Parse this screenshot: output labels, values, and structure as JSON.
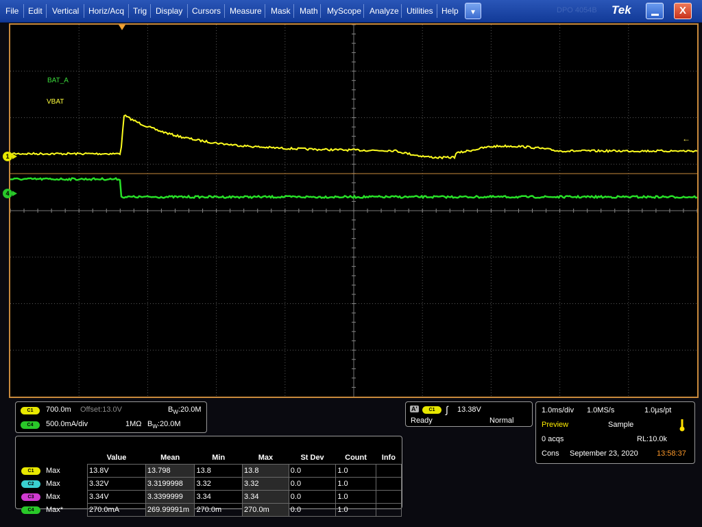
{
  "menubar": {
    "items": [
      "File",
      "Edit",
      "Vertical",
      "Horiz/Acq",
      "Trig",
      "Display",
      "Cursors",
      "Measure",
      "Mask",
      "Math",
      "MyScope",
      "Analyze",
      "Utilities",
      "Help"
    ],
    "dropdown_glyph": "▾",
    "brand": "Tek",
    "faint_text": "DPO 4054B",
    "minimize_icon": "minimize-icon",
    "close_label": "X"
  },
  "screen": {
    "ch_labels": {
      "bat_a": "BAT_A",
      "vbat": "VBAT"
    },
    "ch1_marker": "1",
    "ch4_marker": "4",
    "colors": {
      "ch1": "#ffff20",
      "ch4": "#28e028",
      "grid": "#5a5a5a",
      "ref": "#c98a3c"
    }
  },
  "channel_panel": {
    "ch1": {
      "badge": "C1",
      "scale": "700.0m",
      "offset": "Offset:13.0V",
      "bw": "20.0M"
    },
    "ch4": {
      "badge": "C4",
      "scale": "500.0mA/div",
      "impedance": "1MΩ",
      "bw": "20.0M"
    }
  },
  "trigger_panel": {
    "source_marker": "A'",
    "badge": "C1",
    "level": "13.38V",
    "state": "Ready",
    "mode": "Normal"
  },
  "acq_panel": {
    "timebase": "1.0ms/div",
    "sample_rate": "1.0MS/s",
    "resolution": "1.0µs/pt",
    "preview": "Preview",
    "acq_mode": "Sample",
    "acqs": "0 acqs",
    "record_length": "RL:10.0k",
    "cons": "Cons",
    "date": "September 23, 2020",
    "time": "13:58:37"
  },
  "measurements": {
    "headers": [
      "Value",
      "Mean",
      "Min",
      "Max",
      "St Dev",
      "Count",
      "Info"
    ],
    "rows": [
      {
        "badge": "C1",
        "type": "Max",
        "value": "13.8V",
        "mean": "13.798",
        "min": "13.8",
        "max": "13.8",
        "stdev": "0.0",
        "count": "1.0",
        "info": ""
      },
      {
        "badge": "C2",
        "type": "Max",
        "value": "3.32V",
        "mean": "3.3199998",
        "min": "3.32",
        "max": "3.32",
        "stdev": "0.0",
        "count": "1.0",
        "info": ""
      },
      {
        "badge": "C3",
        "type": "Max",
        "value": "3.34V",
        "mean": "3.3399999",
        "min": "3.34",
        "max": "3.34",
        "stdev": "0.0",
        "count": "1.0",
        "info": ""
      },
      {
        "badge": "C4",
        "type": "Max*",
        "value": "270.0mA",
        "mean": "269.99991m",
        "min": "270.0m",
        "max": "270.0m",
        "stdev": "0.0",
        "count": "1.0",
        "info": ""
      }
    ]
  }
}
